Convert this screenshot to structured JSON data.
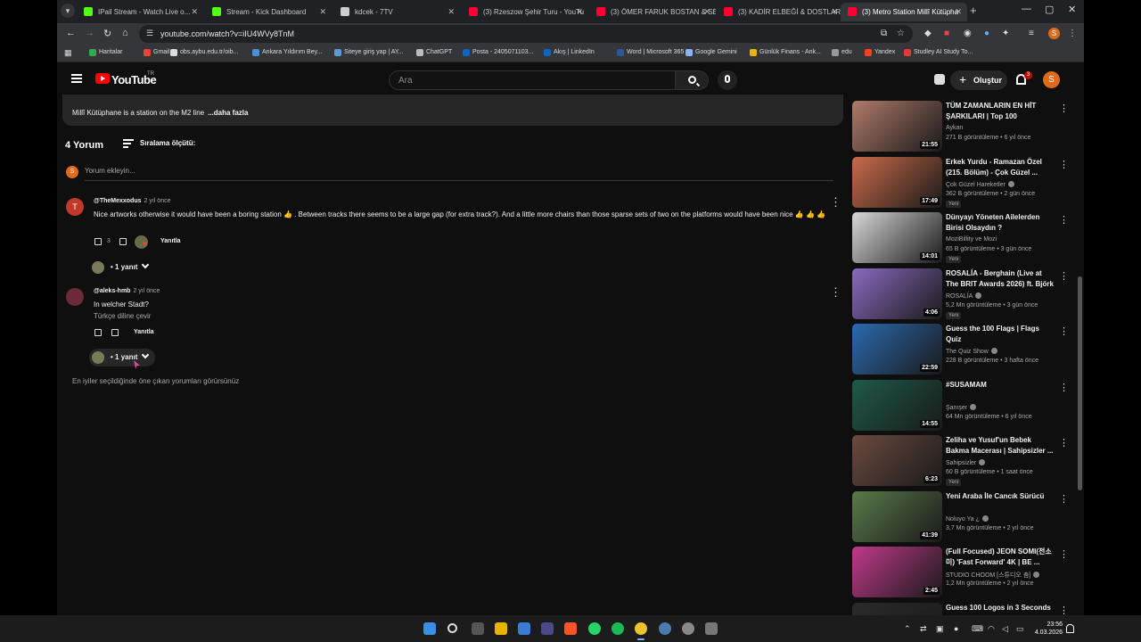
{
  "browser": {
    "tabs": [
      {
        "title": "IPail Stream - Watch Live o...",
        "color": "#53fc18",
        "muted": true
      },
      {
        "title": "Stream - Kick Dashboard",
        "color": "#53fc18"
      },
      {
        "title": "kdcek - 7TV",
        "color": "#cccccc"
      },
      {
        "title": "(3) Rzeszow Şehir Turu - YouTu",
        "color": "#ff0033"
      },
      {
        "title": "(3) ÖMER FARUK BOSTAN & SE",
        "color": "#ff0033"
      },
      {
        "title": "(3) KADİR ELBEĞİ & DOSTLAR",
        "color": "#ff0033"
      },
      {
        "title": "(3) Metro Station Millî Kütüpha",
        "color": "#ff0033"
      }
    ],
    "url": "youtube.com/watch?v=iIU4WVy8TnM",
    "bookmarks": [
      {
        "label": "Haritalar",
        "color": "#34a853"
      },
      {
        "label": "Gmail",
        "color": "#ea4335"
      },
      {
        "label": "obs.aybu.edu.tr/oib...",
        "color": "#dddddd"
      },
      {
        "label": "Ankara Yıldırım Bey...",
        "color": "#4a90d9"
      },
      {
        "label": "Siteye giriş yap | AY...",
        "color": "#5b9bd5"
      },
      {
        "label": "ChatGPT",
        "color": "#bbbbbb"
      },
      {
        "label": "Posta - 2405071103...",
        "color": "#0a66c2"
      },
      {
        "label": "Akış | LinkedIn",
        "color": "#0a66c2"
      },
      {
        "label": "Word | Microsoft 365",
        "color": "#2b579a"
      },
      {
        "label": "Google Gemini",
        "color": "#8ab4f8"
      },
      {
        "label": "Günlük Finans - Ank...",
        "color": "#e8b400"
      },
      {
        "label": "edu",
        "color": "#999999"
      },
      {
        "label": "Yandex",
        "color": "#fc3f1d"
      },
      {
        "label": "Studley AI Study To...",
        "color": "#e53935"
      }
    ]
  },
  "youtube": {
    "logo_text": "YouTube",
    "country": "TR",
    "search_placeholder": "Ara",
    "create_label": "Oluştur",
    "notification_count": "3",
    "avatar_letter": "S"
  },
  "description": {
    "text": "Millî Kütüphane is a station on the M2 line",
    "more": "...daha fazla"
  },
  "comments": {
    "count_label": "4 Yorum",
    "sort_label": "Sıralama ölçütü:",
    "add_placeholder": "Yorum ekleyin...",
    "items": [
      {
        "avatar_letter": "T",
        "avatar_color": "#c0392b",
        "author": "@TheMexxodus",
        "time": "2 yıl önce",
        "text": "Nice artworks otherwise it would have been a boring station 👍 . Between tracks there seems to be a large gap (for extra track?). And a little more chairs than those sparse sets of two on the platforms would have been nice 👍 👍 👍",
        "likes": "3",
        "reply_label": "Yanıtla",
        "replies_label": "• 1 yanıt"
      },
      {
        "avatar_letter": "",
        "avatar_color": "#6b2a3a",
        "author": "@aleks-hmb",
        "time": "2 yıl önce",
        "text": "In welcher Stadt?",
        "translate": "Türkçe diline çevir",
        "likes": "",
        "reply_label": "Yanıtla",
        "replies_label": "• 1 yanıt"
      }
    ],
    "footnote": "En iyiler seçildiğinde öne çıkan yorumları görürsünüz"
  },
  "sidebar": {
    "videos": [
      {
        "title": "TÜM ZAMANLARIN EN HİT ŞARKILARI | Top 100",
        "channel": "Aykan",
        "verified": false,
        "meta": "271 B görüntüleme • 6 yıl önce",
        "duration": "21:55",
        "new": false,
        "thumb": "#b07a6a"
      },
      {
        "title": "Erkek Yurdu - Ramazan Özel (215. Bölüm) - Çok Güzel ...",
        "channel": "Çok Güzel Hareketler",
        "verified": true,
        "meta": "362 B görüntüleme • 2 gün önce",
        "duration": "17:49",
        "new": true,
        "thumb": "#c96b4a"
      },
      {
        "title": "Dünyayı Yöneten Ailelerden Birisi Olsaydın ?",
        "channel": "MoziBillity ve Mozi",
        "verified": false,
        "meta": "65 B görüntüleme • 3 gün önce",
        "duration": "14:01",
        "new": true,
        "thumb": "#d8d8d8"
      },
      {
        "title": "ROSALÍA - Berghain (Live at The BRIT Awards 2026) ft. Björk",
        "channel": "ROSALÍA",
        "verified": true,
        "meta": "5,2 Mn görüntüleme • 3 gün önce",
        "duration": "4:06",
        "new": true,
        "thumb": "#8a6ac0"
      },
      {
        "title": "Guess the 100 Flags | Flags Quiz",
        "channel": "The Quiz Show",
        "verified": true,
        "meta": "228 B görüntüleme • 3 hafta önce",
        "duration": "22:59",
        "new": false,
        "thumb": "#2a6ab0"
      },
      {
        "title": "#SUSAMAM",
        "channel": "Şanışer",
        "verified": true,
        "meta": "64 Mn görüntüleme • 6 yıl önce",
        "duration": "14:55",
        "new": false,
        "thumb": "#1e5a48"
      },
      {
        "title": "Zeliha ve Yusuf'un Bebek Bakma Macerası | Sahipsizler ...",
        "channel": "Sahipsizler",
        "verified": true,
        "meta": "60 B görüntüleme • 1 saat önce",
        "duration": "6:23",
        "new": true,
        "thumb": "#6a4a40"
      },
      {
        "title": "Yeni Araba İle Cancık Sürücü",
        "channel": "Noluyo Ya ¿",
        "verified": true,
        "meta": "3,7 Mn görüntüleme • 2 yıl önce",
        "duration": "41:39",
        "new": false,
        "thumb": "#5a7a4a"
      },
      {
        "title": "(Full Focused) JEON SOMI(전소미) 'Fast Forward' 4K | BE ...",
        "channel": "STUDIO CHOOM [스튜디오 춤]",
        "verified": true,
        "meta": "1,2 Mn görüntüleme • 2 yıl önce",
        "duration": "2:45",
        "new": false,
        "thumb": "#c03a8a"
      },
      {
        "title": "Guess 100 Logos in 3 Seconds",
        "channel": "",
        "verified": false,
        "meta": "",
        "duration": "",
        "new": false,
        "thumb": "#2a2a2a"
      }
    ]
  },
  "taskbar": {
    "time": "23:56",
    "date": "4.03.2026"
  }
}
